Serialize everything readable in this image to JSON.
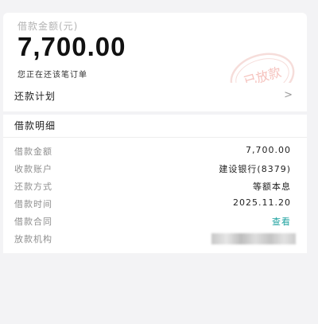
{
  "summary": {
    "amount_label": "借款金额(元)",
    "amount_value": "7,700.00",
    "status_text": "您正在还该笔订单",
    "stamp_text": "已放款"
  },
  "plan": {
    "label": "还款计划",
    "chevron": ">"
  },
  "detail": {
    "title": "借款明细",
    "rows": [
      {
        "label": "借款金额",
        "value": "7,700.00"
      },
      {
        "label": "收款账户",
        "value": "建设银行(8379)"
      },
      {
        "label": "还款方式",
        "value": "等额本息"
      },
      {
        "label": "借款时间",
        "value": "2025.11.20"
      },
      {
        "label": "借款合同",
        "value": "查看"
      },
      {
        "label": "放款机构",
        "value": ""
      }
    ]
  },
  "colors": {
    "background": "#f3f3f5",
    "card": "#ffffff",
    "link": "#1fa3a0",
    "stamp": "#f0c2bd"
  },
  "icons": {
    "chevron": "chevron-right-icon",
    "stamp": "loan-disbursed-stamp"
  }
}
